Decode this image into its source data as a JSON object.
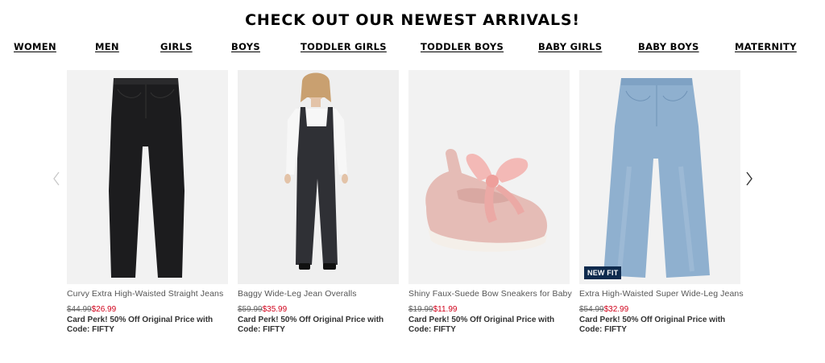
{
  "headline": "CHECK OUT OUR NEWEST ARRIVALS!",
  "nav": [
    "WOMEN",
    "MEN",
    "GIRLS",
    "BOYS",
    "TODDLER GIRLS",
    "TODDLER BOYS",
    "BABY GIRLS",
    "BABY BOYS",
    "MATERNITY"
  ],
  "products": [
    {
      "title": "Curvy Extra High-Waisted Straight Jeans",
      "old_price": "$44.99",
      "new_price": "$26.99",
      "perk": "Card Perk! 50% Off Original Price with Code: FIFTY",
      "image": "black-jeans"
    },
    {
      "title": "Baggy Wide-Leg Jean Overalls",
      "old_price": "$59.99",
      "new_price": "$35.99",
      "perk": "Card Perk! 50% Off Original Price with Code: FIFTY",
      "image": "model-overalls"
    },
    {
      "title": "Shiny Faux-Suede Bow Sneakers for Baby",
      "old_price": "$19.99",
      "new_price": "$11.99",
      "perk": "Card Perk! 50% Off Original Price with Code: FIFTY",
      "image": "pink-baby-sneaker"
    },
    {
      "title": "Extra High-Waisted Super Wide-Leg Jeans",
      "old_price": "$54.99",
      "new_price": "$32.99",
      "perk": "Card Perk! 50% Off Original Price with Code: FIFTY",
      "badge": "NEW FIT",
      "image": "light-blue-jeans"
    }
  ],
  "colors": {
    "sale_price": "#d0021b",
    "badge_bg": "#0e2a4d"
  },
  "icons": {
    "prev": "chevron-left-icon",
    "next": "chevron-right-icon"
  }
}
